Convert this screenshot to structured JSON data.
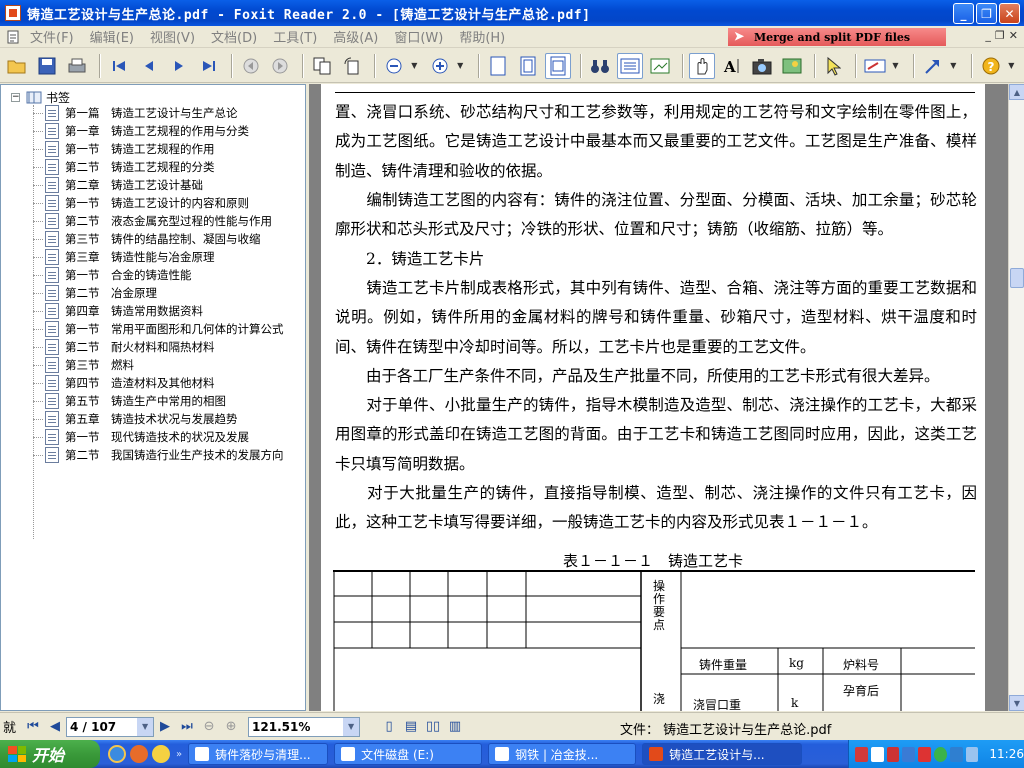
{
  "window": {
    "title": "铸造工艺设计与生产总论.pdf - Foxit Reader 2.0 - [铸造工艺设计与生产总论.pdf]",
    "minimize": "_",
    "restore": "❐",
    "close": "✕"
  },
  "menu": {
    "items": [
      "文件(F)",
      "编辑(E)",
      "视图(V)",
      "文档(D)",
      "工具(T)",
      "高级(A)",
      "窗口(W)",
      "帮助(H)"
    ],
    "promo": "Merge and split PDF files",
    "doc_min": "_",
    "doc_restore": "❐",
    "doc_close": "✕"
  },
  "bookmarks": {
    "root_toggle": "−",
    "root_label": "书签",
    "items": [
      "第一篇　铸造工艺设计与生产总论",
      "第一章　铸造工艺规程的作用与分类",
      "第一节　铸造工艺规程的作用",
      "第二节　铸造工艺规程的分类",
      "第二章　铸造工艺设计基础",
      "第一节　铸造工艺设计的内容和原则",
      "第二节　液态金属充型过程的性能与作用",
      "第三节　铸件的结晶控制、凝固与收缩",
      "第三章　铸造性能与冶金原理",
      "第一节　合金的铸造性能",
      "第二节　冶金原理",
      "第四章　铸造常用数据资料",
      "第一节　常用平面图形和几何体的计算公式",
      "第二节　耐火材料和隔热材料",
      "第三节　燃料",
      "第四节　造渣材料及其他材料",
      "第五节　铸造生产中常用的相图",
      "第五章　铸造技术状况与发展趋势",
      "第一节　现代铸造技术的状况及发展",
      "第二节　我国铸造行业生产技术的发展方向"
    ]
  },
  "document": {
    "paragraphs": [
      "置、浇冒口系统、砂芯结构尺寸和工艺参数等，利用规定的工艺符号和文字绘制在零件图上，成为工艺图纸。它是铸造工艺设计中最基本而又最重要的工艺文件。工艺图是生产准备、模样制造、铸件清理和验收的依据。",
      "　　编制铸造工艺图的内容有：铸件的浇注位置、分型面、分模面、活块、加工余量；砂芯轮廓形状和芯头形式及尺寸；冷铁的形状、位置和尺寸；铸筋（收缩筋、拉筋）等。",
      "　　2．铸造工艺卡片",
      "　　铸造工艺卡片制成表格形式，其中列有铸件、造型、合箱、浇注等方面的重要工艺数据和说明。例如，铸件所用的金属材料的牌号和铸件重量、砂箱尺寸，造型材料、烘干温度和时间、铸件在铸型中冷却时间等。所以，工艺卡片也是重要的工艺文件。",
      "　　由于各工厂生产条件不同，产品及生产批量不同，所使用的工艺卡形式有很大差异。",
      "　　对于单件、小批量生产的铸件，指导木模制造及造型、制芯、浇注操作的工艺卡，大都采用图章的形式盖印在铸造工艺图的背面。由于工艺卡和铸造工艺图同时应用，因此，这类工艺卡只填写简明数据。",
      "　　对于大批量生产的铸件，直接指导制模、造型、制芯、浇注操作的文件只有工艺卡，因此，这种工艺卡填写得要详细，一般铸造工艺卡的内容及形式见表１－１－１。"
    ],
    "table_caption": "表１－１－１　铸造工艺卡",
    "table": {
      "op_label": "操作要点",
      "pour_label": "浇",
      "weight_label": "铸件重量",
      "kg": "kg",
      "charge_label": "炉料号",
      "riser_label": "浇冒口重",
      "riser_unit": "k",
      "inoc_label": "孕育后"
    }
  },
  "status": {
    "label": "就",
    "page": "4 / 107",
    "zoom": "121.51%",
    "file": "文件： 铸造工艺设计与生产总论.pdf"
  },
  "taskbar": {
    "start": "开始",
    "tasks": [
      "铸件落砂与清理...",
      "文件磁盘 (E:)",
      "钢铁 | 冶金技...",
      "铸造工艺设计与..."
    ],
    "clock": "11:26"
  }
}
